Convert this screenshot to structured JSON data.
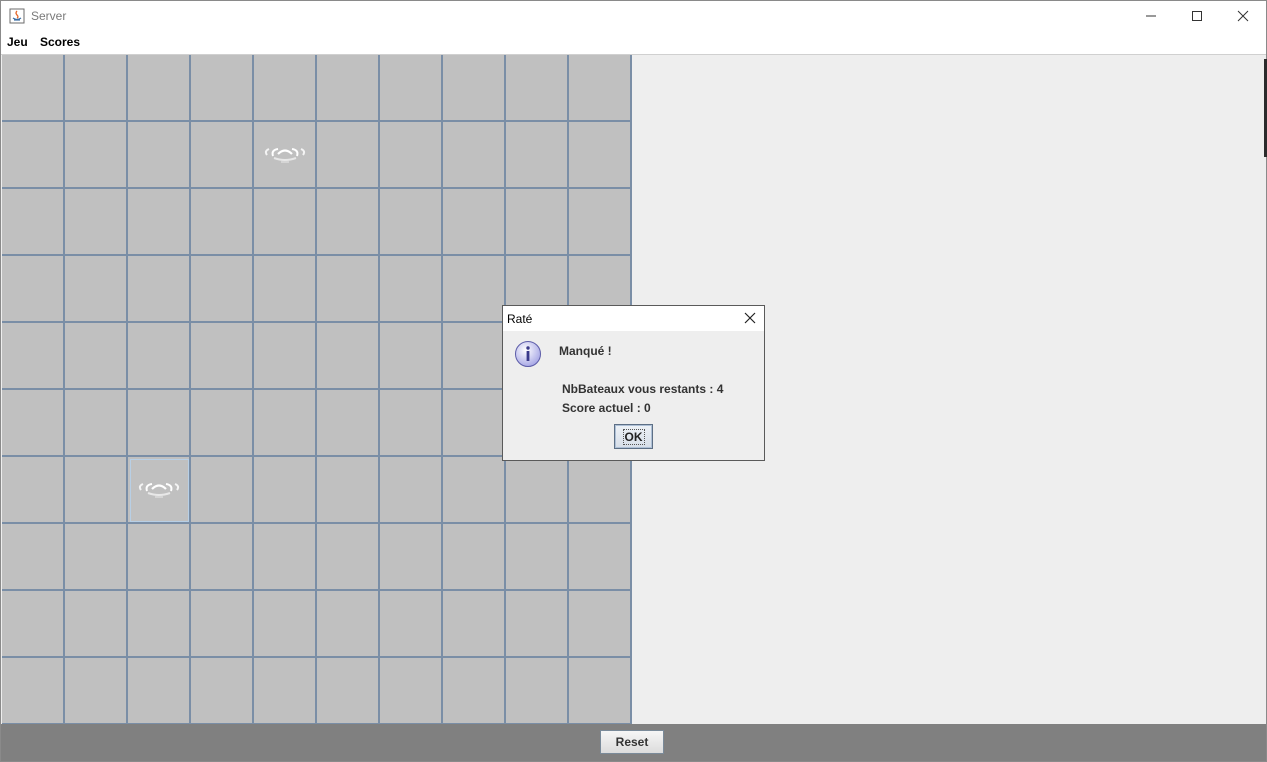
{
  "window": {
    "title": "Server",
    "icon": "java-icon",
    "controls": [
      "minimize-icon",
      "maximize-icon",
      "close-icon"
    ]
  },
  "menu": {
    "items": [
      {
        "label": "Jeu"
      },
      {
        "label": "Scores"
      }
    ]
  },
  "board": {
    "rows": 10,
    "cols": 10,
    "cell_color": "#c0c0c0",
    "grid_line_color": "#7a8ea6",
    "marked_cells": [
      {
        "row": 1,
        "col": 4,
        "marker": "miss-splash-icon"
      },
      {
        "row": 6,
        "col": 2,
        "marker": "miss-splash-icon",
        "selected": true
      }
    ]
  },
  "footer": {
    "reset_label": "Reset"
  },
  "dialog": {
    "title": "Raté",
    "icon": "info-icon",
    "heading": "Manqué !",
    "line1": "NbBateaux vous restants : 4",
    "line2": "Score actuel : 0",
    "ok_label": "OK"
  }
}
